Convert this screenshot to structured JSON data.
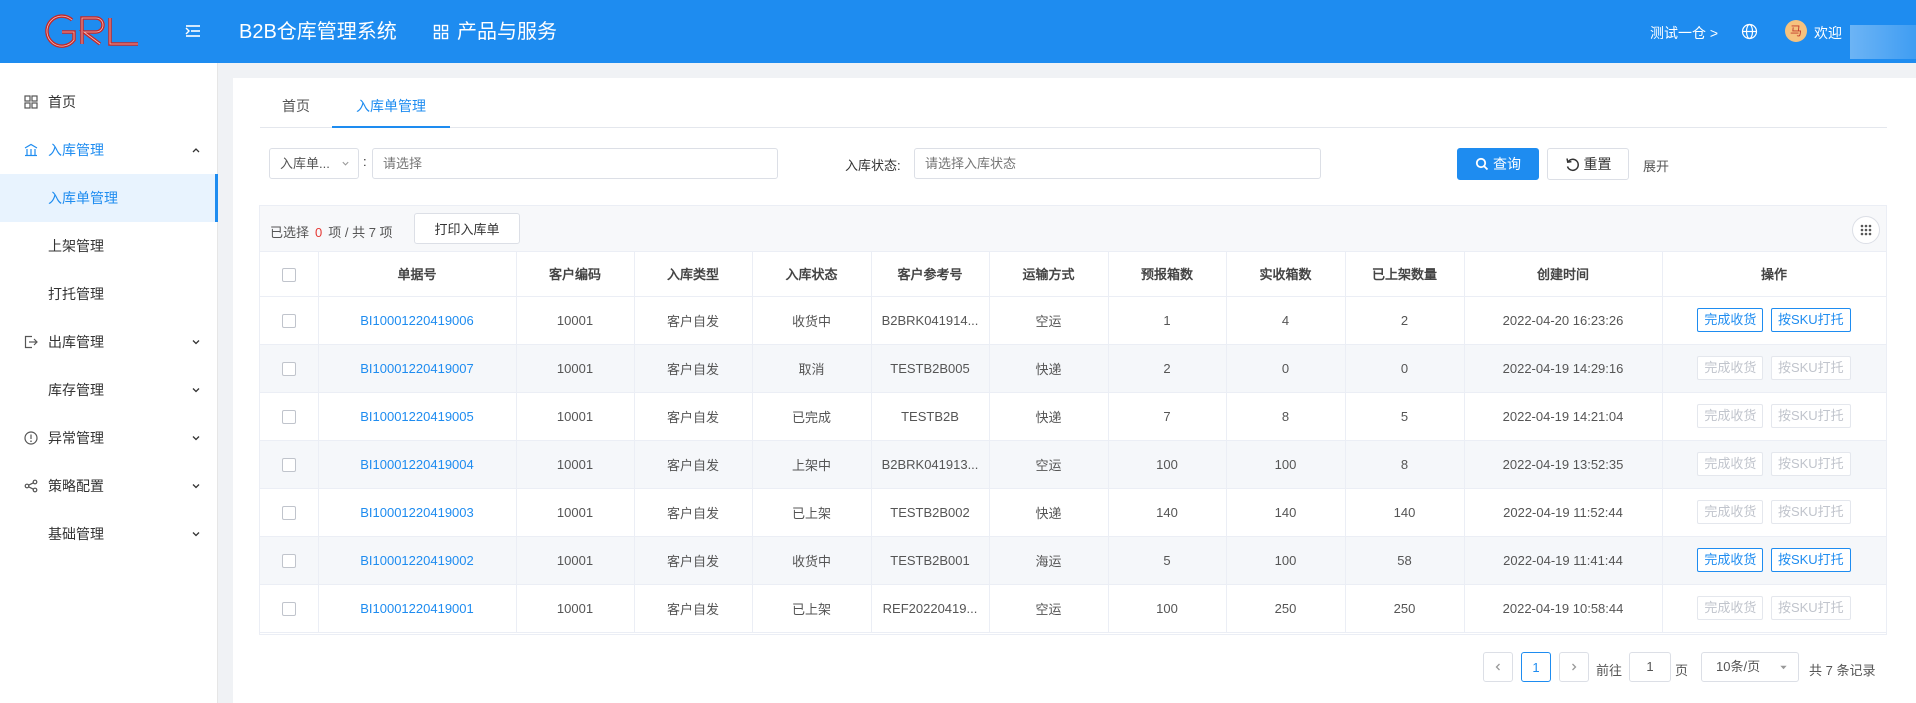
{
  "header": {
    "app_title": "B2B仓库管理系统",
    "products": "产品与服务",
    "warehouse": "测试一仓 >",
    "avatar_char": "马",
    "welcome": "欢迎",
    "bg_color": "#1e8cf0"
  },
  "sidebar": {
    "items": [
      {
        "label": "首页",
        "icon": "grid-icon"
      },
      {
        "label": "入库管理",
        "icon": "warehouse-icon",
        "expanded": true
      },
      {
        "label": "入库单管理",
        "active": true
      },
      {
        "label": "上架管理"
      },
      {
        "label": "打托管理"
      },
      {
        "label": "出库管理",
        "icon": "exit-icon"
      },
      {
        "label": "库存管理"
      },
      {
        "label": "异常管理",
        "icon": "alert-icon"
      },
      {
        "label": "策略配置",
        "icon": "share-icon"
      },
      {
        "label": "基础管理"
      }
    ]
  },
  "tabs": [
    "首页",
    "入库单管理"
  ],
  "filters": {
    "field_select": "入库单...",
    "field_placeholder": "请选择",
    "status_label": "入库状态:",
    "status_placeholder": "请选择入库状态",
    "query": "查询",
    "reset": "重置",
    "expand": "展开"
  },
  "toolbar": {
    "selected_prefix": "已选择",
    "selected_count": "0",
    "selected_suffix": "项 / 共 7 项",
    "print": "打印入库单"
  },
  "table": {
    "columns": [
      "单据号",
      "客户编码",
      "入库类型",
      "入库状态",
      "客户参考号",
      "运输方式",
      "预报箱数",
      "实收箱数",
      "已上架数量",
      "创建时间",
      "操作"
    ],
    "rows": [
      {
        "no": "BI10001220419006",
        "cust": "10001",
        "type": "客户自发",
        "status": "收货中",
        "ref": "B2BRK041914...",
        "ship": "空运",
        "fc": "1",
        "rc": "4",
        "sh": "2",
        "time": "2022-04-20 16:23:26",
        "enabled": true
      },
      {
        "no": "BI10001220419007",
        "cust": "10001",
        "type": "客户自发",
        "status": "取消",
        "ref": "TESTB2B005",
        "ship": "快递",
        "fc": "2",
        "rc": "0",
        "sh": "0",
        "time": "2022-04-19 14:29:16",
        "enabled": false
      },
      {
        "no": "BI10001220419005",
        "cust": "10001",
        "type": "客户自发",
        "status": "已完成",
        "ref": "TESTB2B",
        "ship": "快递",
        "fc": "7",
        "rc": "8",
        "sh": "5",
        "time": "2022-04-19 14:21:04",
        "enabled": false
      },
      {
        "no": "BI10001220419004",
        "cust": "10001",
        "type": "客户自发",
        "status": "上架中",
        "ref": "B2BRK041913...",
        "ship": "空运",
        "fc": "100",
        "rc": "100",
        "sh": "8",
        "time": "2022-04-19 13:52:35",
        "enabled": false
      },
      {
        "no": "BI10001220419003",
        "cust": "10001",
        "type": "客户自发",
        "status": "已上架",
        "ref": "TESTB2B002",
        "ship": "快递",
        "fc": "140",
        "rc": "140",
        "sh": "140",
        "time": "2022-04-19 11:52:44",
        "enabled": false
      },
      {
        "no": "BI10001220419002",
        "cust": "10001",
        "type": "客户自发",
        "status": "收货中",
        "ref": "TESTB2B001",
        "ship": "海运",
        "fc": "5",
        "rc": "100",
        "sh": "58",
        "time": "2022-04-19 11:41:44",
        "enabled": true
      },
      {
        "no": "BI10001220419001",
        "cust": "10001",
        "type": "客户自发",
        "status": "已上架",
        "ref": "REF20220419...",
        "ship": "空运",
        "fc": "100",
        "rc": "250",
        "sh": "250",
        "time": "2022-04-19 10:58:44",
        "enabled": false
      }
    ],
    "op_complete": "完成收货",
    "op_pallet": "按SKU打托"
  },
  "pagination": {
    "current": "1",
    "goto_prefix": "前往",
    "goto_value": "1",
    "goto_suffix": "页",
    "page_size": "10条/页",
    "total": "共 7 条记录"
  }
}
